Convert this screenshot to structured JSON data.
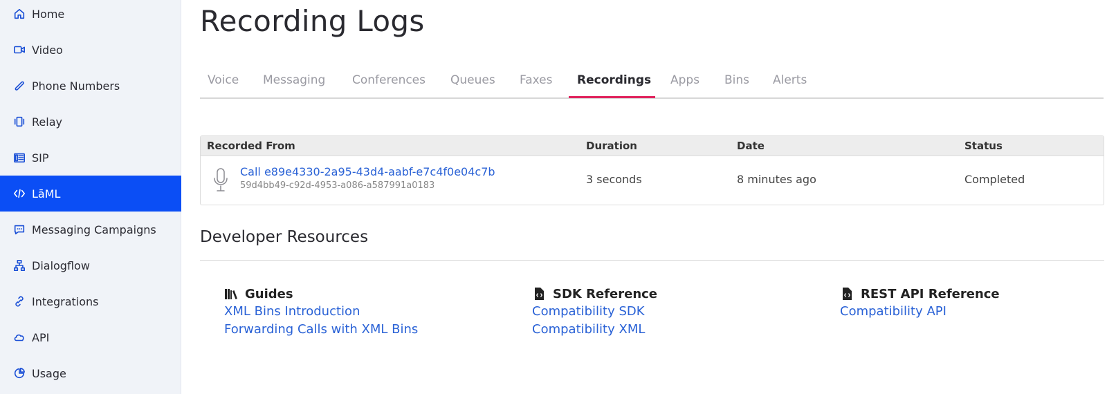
{
  "sidebar": {
    "items": [
      {
        "label": "Home",
        "icon": "home-icon"
      },
      {
        "label": "Video",
        "icon": "video-icon"
      },
      {
        "label": "Phone Numbers",
        "icon": "phone-icon"
      },
      {
        "label": "Relay",
        "icon": "relay-icon"
      },
      {
        "label": "SIP",
        "icon": "sip-icon"
      },
      {
        "label": "LāML",
        "icon": "code-icon",
        "active": true
      },
      {
        "label": "Messaging Campaigns",
        "icon": "message-icon"
      },
      {
        "label": "Dialogflow",
        "icon": "network-icon"
      },
      {
        "label": "Integrations",
        "icon": "link-icon"
      },
      {
        "label": "API",
        "icon": "cloud-icon"
      },
      {
        "label": "Usage",
        "icon": "pie-chart-icon"
      }
    ]
  },
  "page": {
    "title": "Recording Logs"
  },
  "tabs": [
    {
      "label": "Voice"
    },
    {
      "label": "Messaging"
    },
    {
      "label": "Conferences"
    },
    {
      "label": "Queues"
    },
    {
      "label": "Faxes"
    },
    {
      "label": "Recordings",
      "active": true
    },
    {
      "label": "Apps"
    },
    {
      "label": "Bins"
    },
    {
      "label": "Alerts"
    }
  ],
  "table": {
    "headers": {
      "recorded_from": "Recorded From",
      "duration": "Duration",
      "date": "Date",
      "status": "Status"
    },
    "rows": [
      {
        "call": "Call e89e4330-2a95-43d4-aabf-e7c4f0e04c7b",
        "sid": "59d4bb49-c92d-4953-a086-a587991a0183",
        "duration": "3 seconds",
        "date": "8 minutes ago",
        "status": "Completed"
      }
    ]
  },
  "developer_resources": {
    "title": "Developer Resources",
    "columns": [
      {
        "heading": "Guides",
        "icon": "books-icon",
        "links": [
          "XML Bins Introduction",
          "Forwarding Calls with XML Bins"
        ]
      },
      {
        "heading": "SDK Reference",
        "icon": "code-file-icon",
        "links": [
          "Compatibility SDK",
          "Compatibility XML"
        ]
      },
      {
        "heading": "REST API Reference",
        "icon": "code-file-icon",
        "links": [
          "Compatibility API"
        ]
      }
    ]
  },
  "colors": {
    "accent": "#0b4ef5",
    "tab_underline": "#e0245e",
    "link": "#2a62d6"
  }
}
